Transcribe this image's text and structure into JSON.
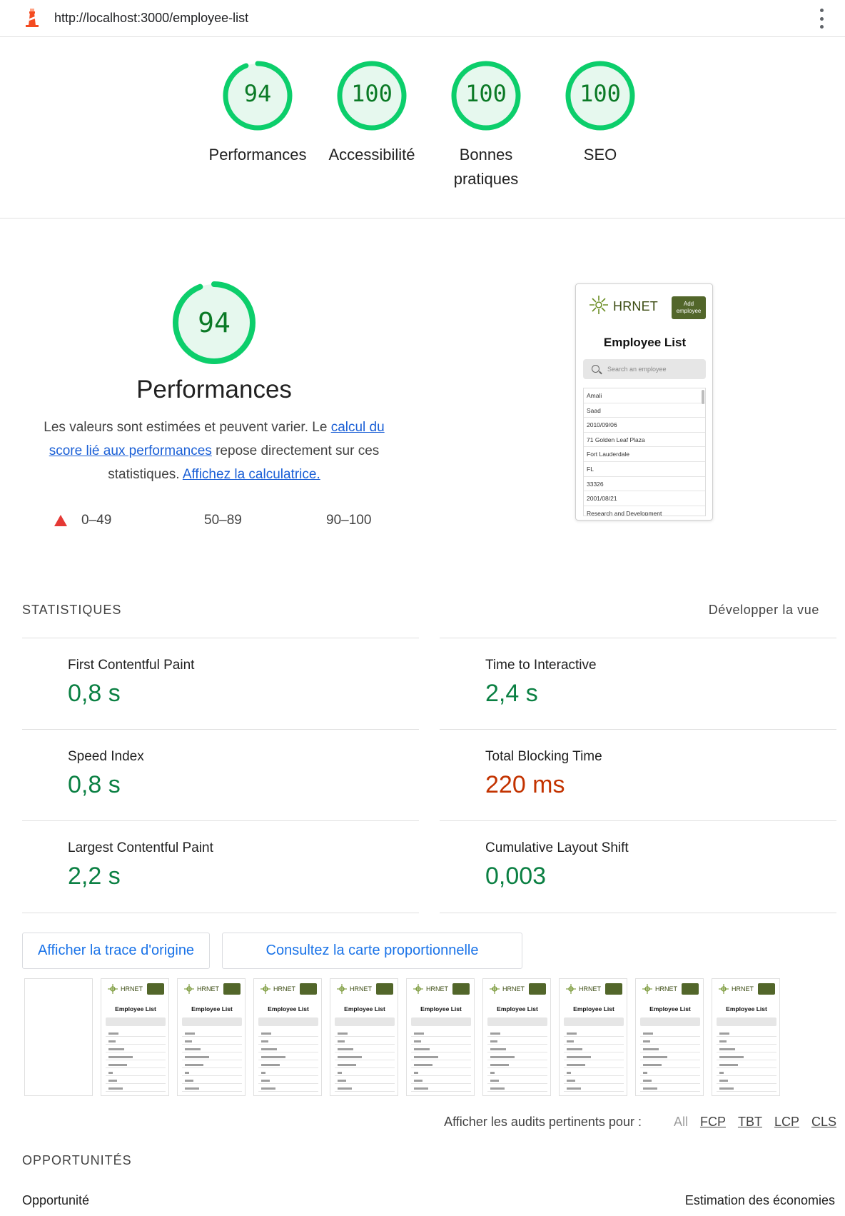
{
  "topbar": {
    "url": "http://localhost:3000/employee-list",
    "logo_icon": "lighthouse-icon",
    "menu_icon": "kebab-menu-icon"
  },
  "gauges": [
    {
      "value": 94,
      "label": "Performances"
    },
    {
      "value": 100,
      "label": "Accessibilité"
    },
    {
      "value": 100,
      "label": "Bonnes pratiques"
    },
    {
      "value": 100,
      "label": "SEO"
    }
  ],
  "colors": {
    "pass": "#0cce6b",
    "pass_text": "#0b8043",
    "fail": "#c33300",
    "fail_triangle": "#e53935",
    "link": "#1a73e8"
  },
  "performance": {
    "score": 94,
    "title": "Performances",
    "desc_1": "Les valeurs sont estimées et peuvent varier. Le ",
    "desc_link_1": "calcul du score lié aux performances",
    "desc_2": " repose directement sur ces statistiques. ",
    "desc_link_2": "Affichez la calculatrice.",
    "legend": [
      "0–49",
      "50–89",
      "90–100"
    ]
  },
  "screenshot": {
    "brand": "HRNET",
    "add_button": "Add employee",
    "title": "Employee List",
    "search_placeholder": "Search an employee",
    "rows": [
      "Amali",
      "Saad",
      "2010/09/06",
      "71 Golden Leaf Plaza",
      "Fort Lauderdale",
      "FL",
      "33326",
      "2001/08/21",
      "Research and Development"
    ]
  },
  "metrics": {
    "section": "STATISTIQUES",
    "expand": "Développer la vue",
    "items": [
      {
        "label": "First Contentful Paint",
        "value": "0,8 s",
        "status": "pass"
      },
      {
        "label": "Time to Interactive",
        "value": "2,4 s",
        "status": "pass"
      },
      {
        "label": "Speed Index",
        "value": "0,8 s",
        "status": "pass"
      },
      {
        "label": "Total Blocking Time",
        "value": "220 ms",
        "status": "fail"
      },
      {
        "label": "Largest Contentful Paint",
        "value": "2,2 s",
        "status": "pass"
      },
      {
        "label": "Cumulative Layout Shift",
        "value": "0,003",
        "status": "pass"
      }
    ]
  },
  "buttons": {
    "trace": "Afficher la trace d'origine",
    "treemap": "Consultez la carte proportionnelle"
  },
  "filmstrip": {
    "frames": 10,
    "brand": "HRNET",
    "title": "Employee List"
  },
  "audit_filter": {
    "label": "Afficher les audits pertinents pour :",
    "options": [
      "All",
      "FCP",
      "TBT",
      "LCP",
      "CLS"
    ]
  },
  "opportunities": {
    "section": "OPPORTUNITÉS",
    "col_left": "Opportunité",
    "col_right": "Estimation des économies"
  }
}
